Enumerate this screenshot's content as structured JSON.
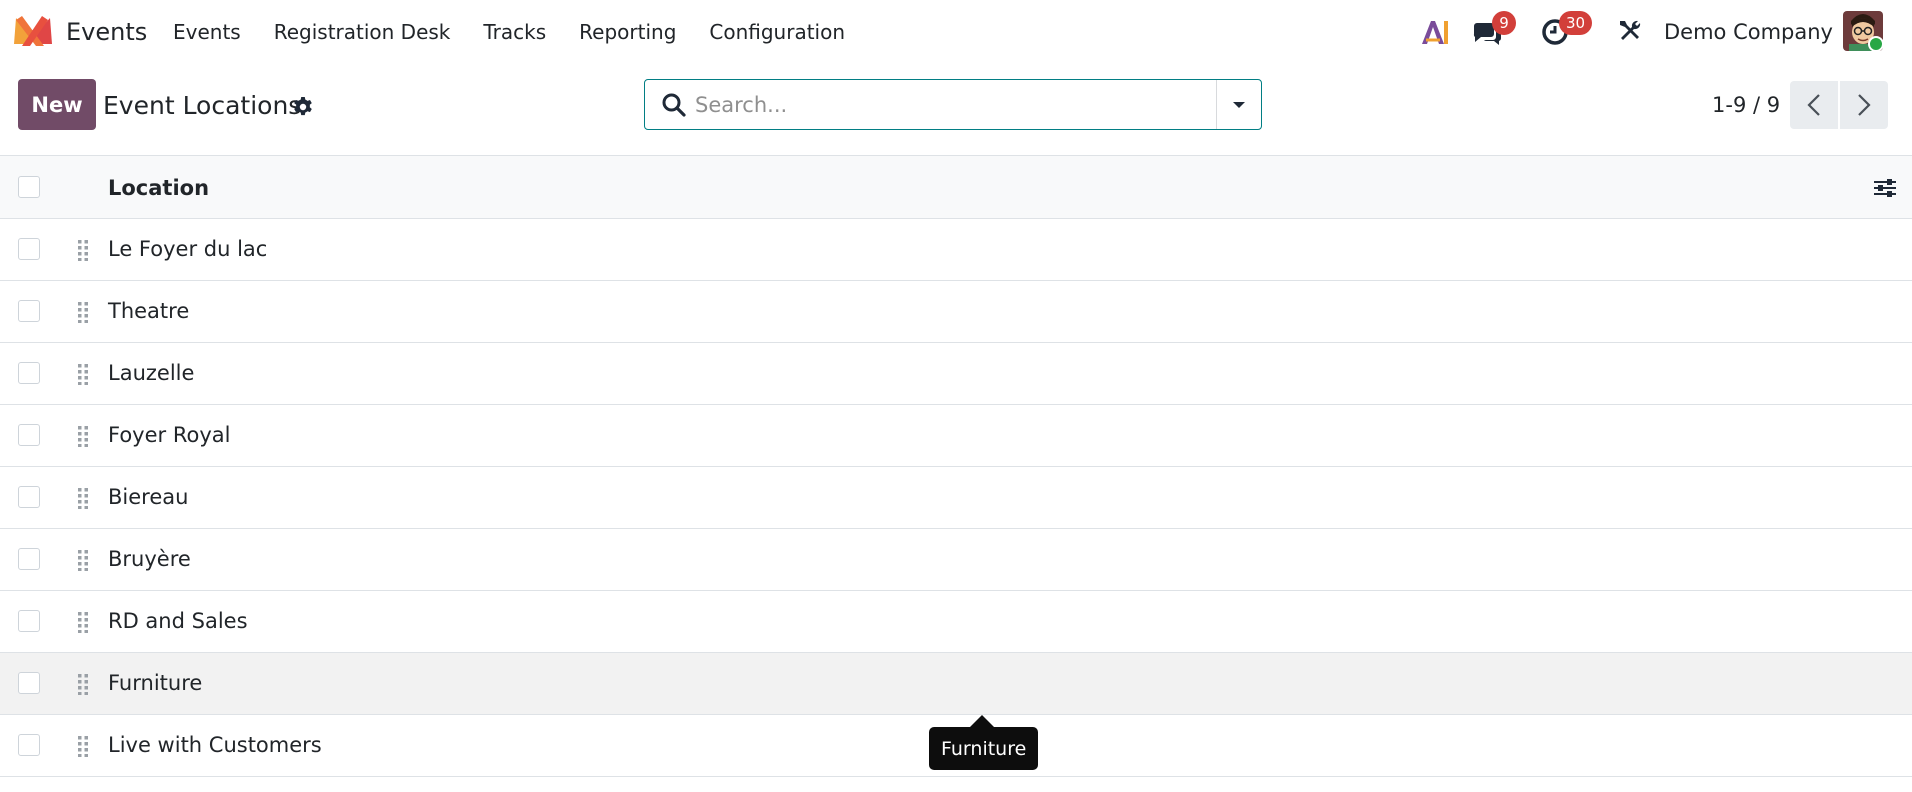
{
  "app": {
    "name": "Events",
    "logo_icon": "odoo-x-logo-icon"
  },
  "nav": {
    "items": [
      "Events",
      "Registration Desk",
      "Tracks",
      "Reporting",
      "Configuration"
    ]
  },
  "systray": {
    "ai_icon": "ai-icon",
    "messages_badge": "9",
    "activities_badge": "30",
    "company": "Demo Company",
    "colors": {
      "badge": "#d23f3a",
      "online": "#28a745"
    }
  },
  "control_panel": {
    "new_label": "New",
    "title": "Event Locations",
    "search_placeholder": "Search...",
    "pager": "1-9 / 9"
  },
  "list": {
    "column_header": "Location",
    "rows": [
      "Le Foyer du lac",
      "Theatre",
      "Lauzelle",
      "Foyer Royal",
      "Biereau",
      "Bruyère",
      "RD and Sales",
      "Furniture",
      "Live with Customers"
    ],
    "hovered_row": "Furniture"
  },
  "tooltip": {
    "text": "Furniture"
  },
  "colors": {
    "primary": "#714b67",
    "search_border": "#017e84"
  }
}
